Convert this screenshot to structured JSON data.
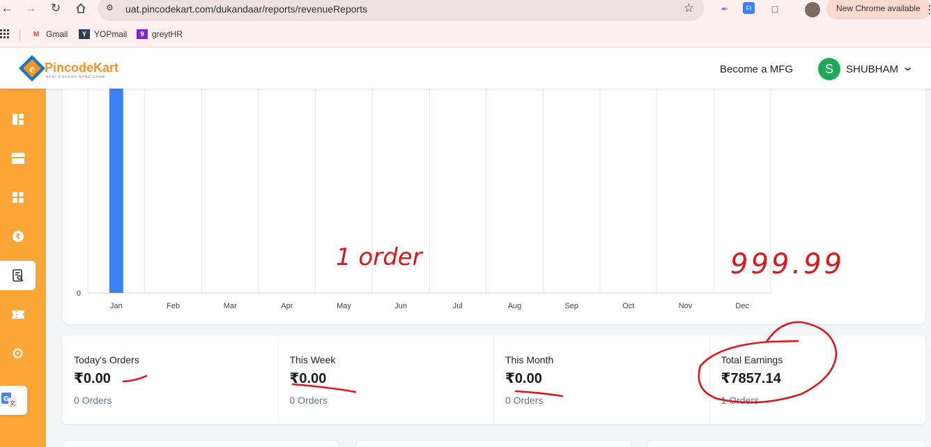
{
  "browser": {
    "url": "uat.pincodekart.com/dukandaar/reports/revenueReports",
    "new_chrome": "New Chrome available",
    "bookmarks": [
      {
        "label": "Gmail",
        "icon": "gmail-icon"
      },
      {
        "label": "YOPmail",
        "icon": "yopmail-icon"
      },
      {
        "label": "greytHR",
        "icon": "greythr-icon"
      }
    ]
  },
  "header": {
    "logo_text": "PincodeKart",
    "logo_tagline": "APNI DUKAAN APNE GHAR",
    "become_mfg": "Become a MFG",
    "avatar_letter": "S",
    "user_name": "SHUBHAM"
  },
  "sidebar": {
    "items": [
      {
        "icon": "dashboard-icon"
      },
      {
        "icon": "store-icon"
      },
      {
        "icon": "categories-icon"
      },
      {
        "icon": "rupee-icon"
      },
      {
        "icon": "report-icon",
        "active": true
      },
      {
        "icon": "ticket-icon"
      },
      {
        "icon": "settings-icon"
      }
    ]
  },
  "chart_data": {
    "type": "bar",
    "categories": [
      "Jan",
      "Feb",
      "Mar",
      "Apr",
      "May",
      "Jun",
      "Jul",
      "Aug",
      "Sep",
      "Oct",
      "Nov",
      "Dec"
    ],
    "values": [
      7857.14,
      0,
      0,
      0,
      0,
      0,
      0,
      0,
      0,
      0,
      0,
      0
    ],
    "y_tick_visible": "0",
    "ylim": [
      0,
      3800
    ],
    "grid": "vertical",
    "bar_color": "#3b82f6"
  },
  "stats": [
    {
      "label": "Today's Orders",
      "value": "₹0.00",
      "orders": "0 Orders"
    },
    {
      "label": "This Week",
      "value": "₹0.00",
      "orders": "0 Orders"
    },
    {
      "label": "This Month",
      "value": "₹0.00",
      "orders": "0 Orders"
    },
    {
      "label": "Total Earnings",
      "value": "₹7857.14",
      "orders": "1 Orders"
    }
  ],
  "annotations": {
    "note_order": "1 order",
    "note_amount": "999.99",
    "color": "#e0141b"
  }
}
